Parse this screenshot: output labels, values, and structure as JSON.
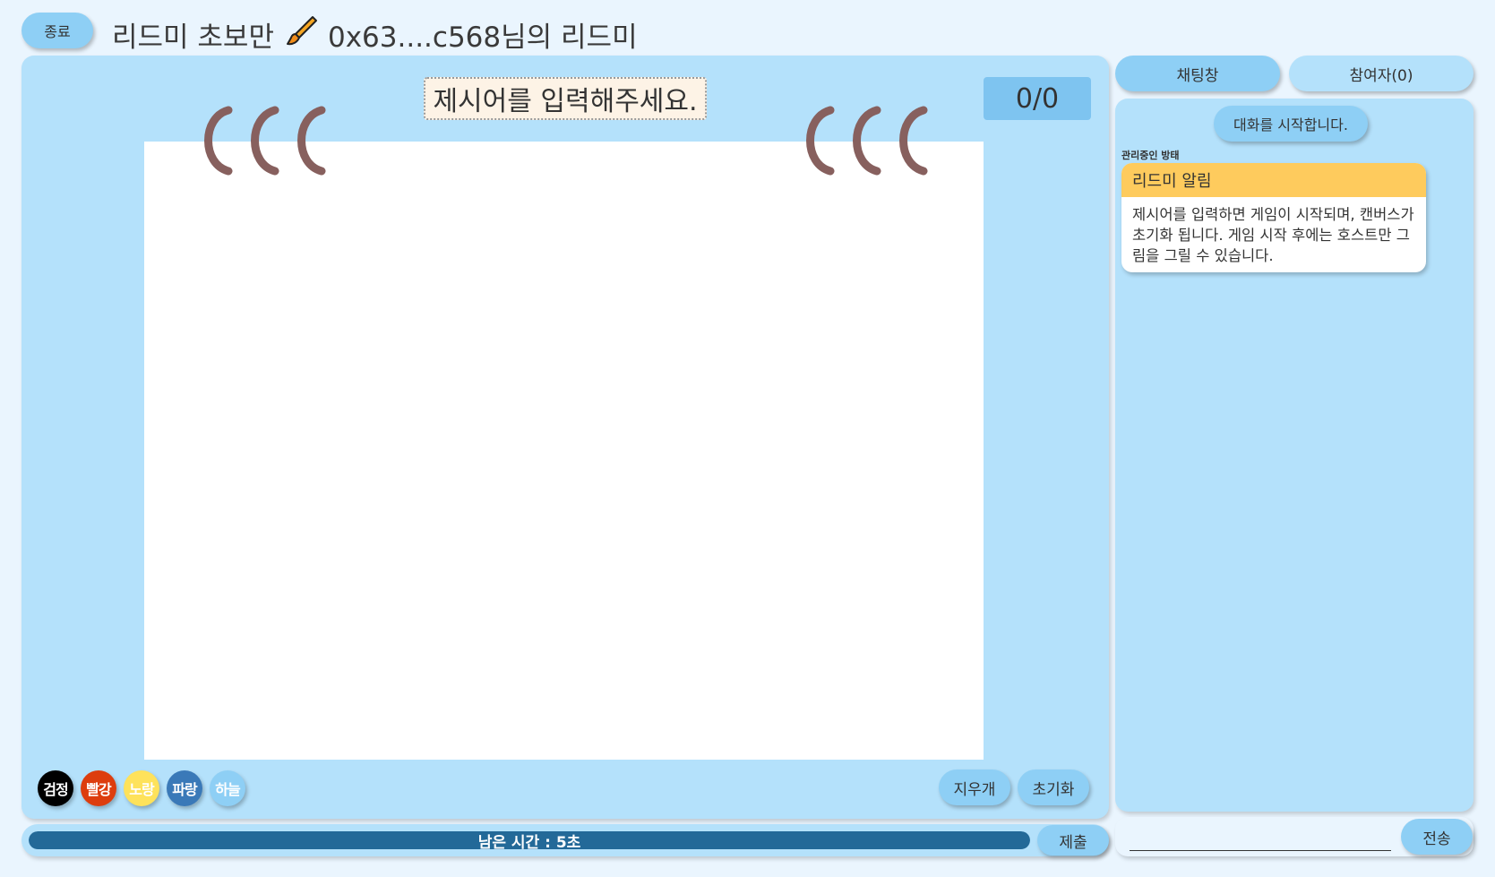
{
  "header": {
    "exit_label": "종료",
    "room_prefix": "리드미 초보만",
    "brush_icon": "paintbrush-icon",
    "room_suffix": "0x63....c568님의 리드미"
  },
  "game": {
    "word_placeholder": "제시어를 입력해주세요.",
    "score": "0/0",
    "bracket_color": "#87605e"
  },
  "palette": [
    {
      "label": "검정",
      "color": "#000000"
    },
    {
      "label": "빨강",
      "color": "#dd3d0e"
    },
    {
      "label": "노랑",
      "color": "#fee25b"
    },
    {
      "label": "파랑",
      "color": "#3a79b8"
    },
    {
      "label": "하늘",
      "color": "#8ecff5"
    }
  ],
  "tools": {
    "eraser_label": "지우개",
    "reset_label": "초기화"
  },
  "timer": {
    "text": "남은 시간 : 5초",
    "progress": 1.0,
    "submit_label": "제출"
  },
  "tabs": {
    "chat_label": "채팅창",
    "members_label": "참여자(0)"
  },
  "chat": {
    "start_notice": "대화를 시작합니다.",
    "messages": [
      {
        "sender": "관리중인 방태",
        "title": "리드미 알림",
        "body": "제시어를 입력하면 게임이 시작되며, 캔버스가 초기화 됩니다. 게임 시작 후에는 호스트만 그림을 그릴 수 있습니다."
      }
    ],
    "input_value": "",
    "send_label": "전송"
  },
  "colors": {
    "background": "#eaf5fe",
    "panel": "#b4e1fb",
    "accent": "#8ecff5",
    "timer_fill": "#236998",
    "notice_header": "#fecb5d"
  }
}
